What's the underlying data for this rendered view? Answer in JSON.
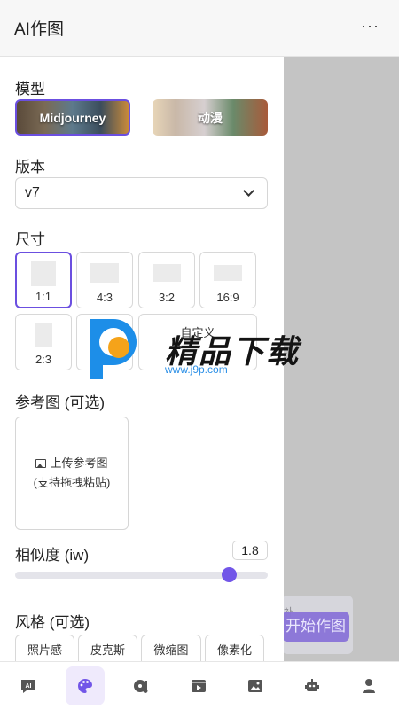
{
  "header": {
    "title": "AI作图",
    "more": "···"
  },
  "model": {
    "label": "模型",
    "options": [
      {
        "name": "Midjourney",
        "selected": true
      },
      {
        "name": "动漫",
        "selected": false
      }
    ]
  },
  "version": {
    "label": "版本",
    "value": "v7"
  },
  "size": {
    "label": "尺寸",
    "options": [
      "1:1",
      "4:3",
      "3:2",
      "16:9",
      "2:3",
      "16",
      "自定义"
    ],
    "selected": "1:1"
  },
  "reference": {
    "label": "参考图 (可选)",
    "upload_line1": "上传参考图",
    "upload_line2": "(支持拖拽粘贴)"
  },
  "similarity": {
    "label": "相似度 (iw)",
    "value": "1.8",
    "fraction": 0.87
  },
  "style": {
    "label": "风格 (可选)",
    "chips": [
      "照片感",
      "皮克斯",
      "微缩图",
      "像素化"
    ]
  },
  "start": {
    "label": "开始作图",
    "side": "补"
  },
  "watermark": {
    "text": "精品下载",
    "url": "www.j9p.com"
  },
  "nav": {
    "items": [
      {
        "icon": "ai-chat-icon"
      },
      {
        "icon": "palette-icon",
        "active": true
      },
      {
        "icon": "music-icon"
      },
      {
        "icon": "video-icon"
      },
      {
        "icon": "image-icon"
      },
      {
        "icon": "robot-icon"
      },
      {
        "icon": "user-icon"
      }
    ]
  },
  "colors": {
    "accent": "#6b4fe0",
    "start_button": "#8a74d8"
  }
}
